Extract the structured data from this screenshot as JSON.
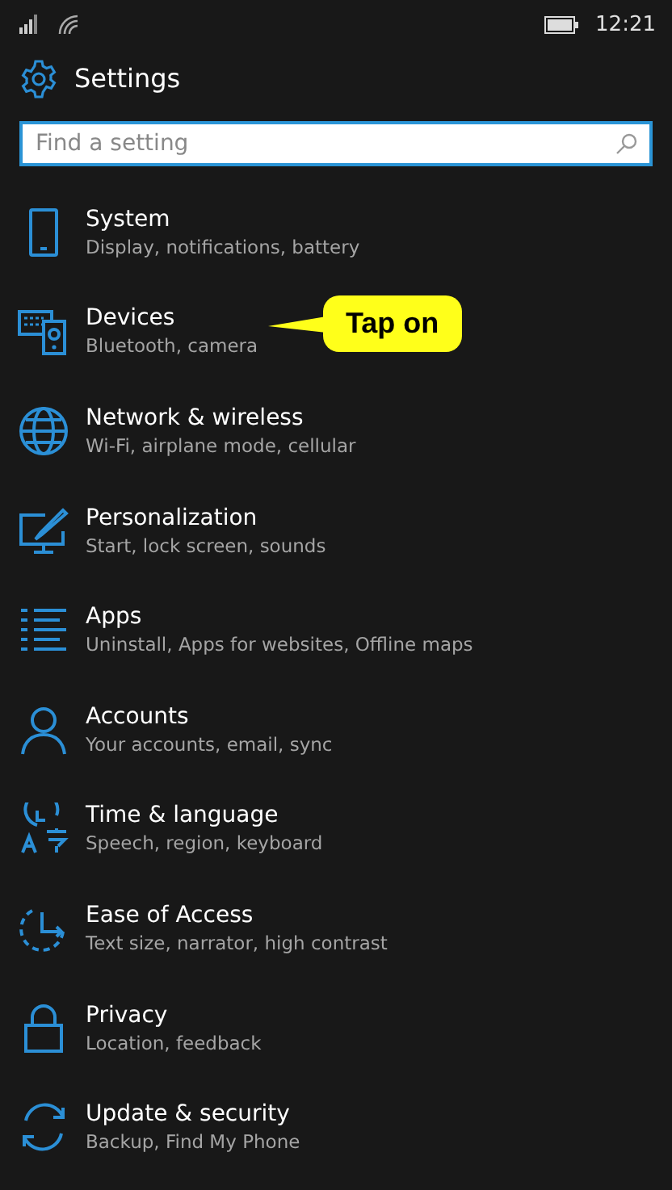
{
  "status_bar": {
    "time": "12:21"
  },
  "header": {
    "title": "Settings"
  },
  "search": {
    "placeholder": "Find a setting"
  },
  "items": [
    {
      "kind": "system",
      "title": "System",
      "subtitle": "Display, notifications, battery"
    },
    {
      "kind": "devices",
      "title": "Devices",
      "subtitle": "Bluetooth, camera",
      "callout": "Tap on"
    },
    {
      "kind": "network",
      "title": "Network & wireless",
      "subtitle": "Wi-Fi, airplane mode, cellular"
    },
    {
      "kind": "personalization",
      "title": "Personalization",
      "subtitle": "Start, lock screen, sounds"
    },
    {
      "kind": "apps",
      "title": "Apps",
      "subtitle": "Uninstall, Apps for websites, Offline maps"
    },
    {
      "kind": "accounts",
      "title": "Accounts",
      "subtitle": "Your accounts, email, sync"
    },
    {
      "kind": "time",
      "title": "Time & language",
      "subtitle": "Speech, region, keyboard"
    },
    {
      "kind": "ease",
      "title": "Ease of Access",
      "subtitle": "Text size, narrator, high contrast"
    },
    {
      "kind": "privacy",
      "title": "Privacy",
      "subtitle": "Location, feedback"
    },
    {
      "kind": "update",
      "title": "Update & security",
      "subtitle": "Backup, Find My Phone"
    }
  ]
}
